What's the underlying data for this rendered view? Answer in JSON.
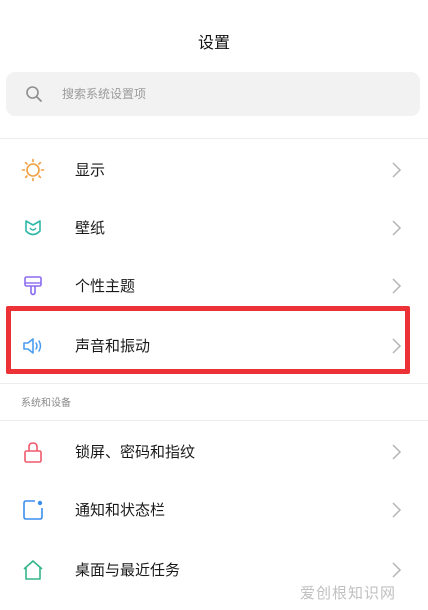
{
  "header": {
    "title": "设置"
  },
  "search": {
    "placeholder": "搜索系统设置项"
  },
  "section_display": {
    "items": [
      {
        "label": "显示"
      },
      {
        "label": "壁纸"
      },
      {
        "label": "个性主题"
      },
      {
        "label": "声音和振动"
      }
    ]
  },
  "section_system": {
    "header": "系统和设备",
    "items": [
      {
        "label": "锁屏、密码和指纹"
      },
      {
        "label": "通知和状态栏"
      },
      {
        "label": "桌面与最近任务"
      }
    ]
  },
  "watermark": "爱创根知识网",
  "colors": {
    "display_icon": "#f0a040",
    "wallpaper_icon": "#2fb7a8",
    "theme_icon": "#8b6cf0",
    "sound_icon": "#4a9cf0",
    "lock_icon": "#ef5a6c",
    "notification_icon": "#3b8ff0",
    "desktop_icon": "#35b58a",
    "highlight": "#ec3237"
  }
}
